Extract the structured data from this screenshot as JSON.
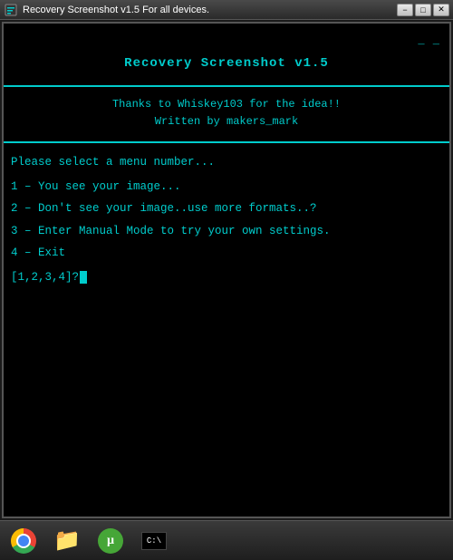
{
  "titleBar": {
    "title": "Recovery Screenshot v1.5  For all devices.",
    "minimizeLabel": "−",
    "maximizeLabel": "□",
    "closeLabel": "✕"
  },
  "terminal": {
    "dashLine": "_ _",
    "appTitle": "Recovery Screenshot v1.5",
    "credits": {
      "line1": "Thanks to Whiskey103 for the idea!!",
      "line2": "Written by makers_mark"
    },
    "menuPrompt": "Please select a menu number...",
    "menuItems": [
      {
        "number": "1",
        "text": "You see your image..."
      },
      {
        "number": "2",
        "text": "Don't see your image..use more formats..?"
      },
      {
        "number": "3",
        "text": "Enter Manual Mode to try your own settings."
      },
      {
        "number": "4",
        "text": "Exit"
      }
    ],
    "inputPrompt": "[1,2,3,4]?"
  },
  "taskbar": {
    "items": [
      {
        "name": "chrome",
        "label": "Chrome"
      },
      {
        "name": "folder",
        "label": "Folder"
      },
      {
        "name": "utorrent",
        "label": "uTorrent"
      },
      {
        "name": "cmd",
        "label": "CMD"
      }
    ]
  }
}
